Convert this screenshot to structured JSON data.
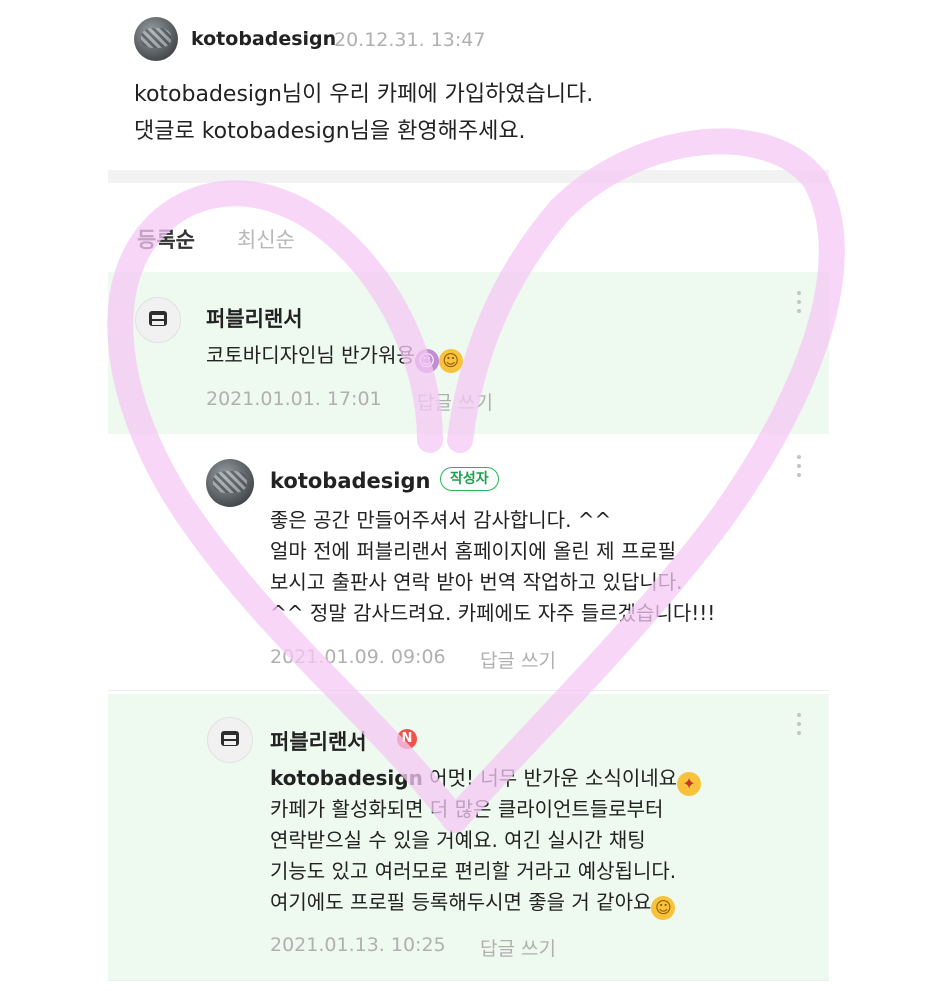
{
  "post": {
    "author": "kotobadesign",
    "datetime": "20.12.31. 13:47",
    "line1": "kotobadesign님이 우리 카페에 가입하였습니다.",
    "line2": "댓글로 kotobadesign님을 환영해주세요."
  },
  "sort": {
    "registered": "등록순",
    "latest": "최신순"
  },
  "comments": [
    {
      "author": "퍼블리랜서",
      "text": "코토바디자인님 반가워용",
      "emoji1": "avatar-emoji",
      "emoji2": "smiling-face-emoji",
      "date": "2021.01.01. 17:01",
      "reply": "답글 쓰기"
    },
    {
      "author": "kotobadesign",
      "badge": "작성자",
      "lines": [
        "좋은 공간 만들어주셔서 감사합니다. ^^",
        "얼마 전에 퍼블리랜서 홈페이지에 올린 제 프로필",
        "보시고 출판사 연락 받아 번역 작업하고 있답니다.",
        "^^ 정말 감사드려요. 카페에도 자주 들르겠습니다!!!"
      ],
      "date": "2021.01.09. 09:06",
      "reply": "답글 쓰기"
    },
    {
      "author": "퍼블리랜서",
      "badge": "N",
      "mention": "kotobadesign",
      "line1_rest": "어멋! 너무 반가운 소식이네요",
      "lines": [
        "카페가 활성화되면 더 많은 클라이언트들로부터",
        "연락받으실 수 있을 거예요. 여긴 실시간 채팅",
        "기능도 있고 여러모로 편리할 거라고 예상됩니다.",
        "여기에도 프로필 등록해두시면 좋을 거 같아요"
      ],
      "date": "2021.01.13. 10:25",
      "reply": "답글 쓰기"
    }
  ],
  "colors": {
    "accent_green": "#27b75a",
    "comment_highlight": "#eef9ef",
    "new_badge": "#f2524b",
    "heart_stroke": "#f4c8f4"
  },
  "icons": [
    "more-vertical-icon",
    "smiling-face-emoji",
    "party-face-emoji",
    "new-badge-icon"
  ]
}
